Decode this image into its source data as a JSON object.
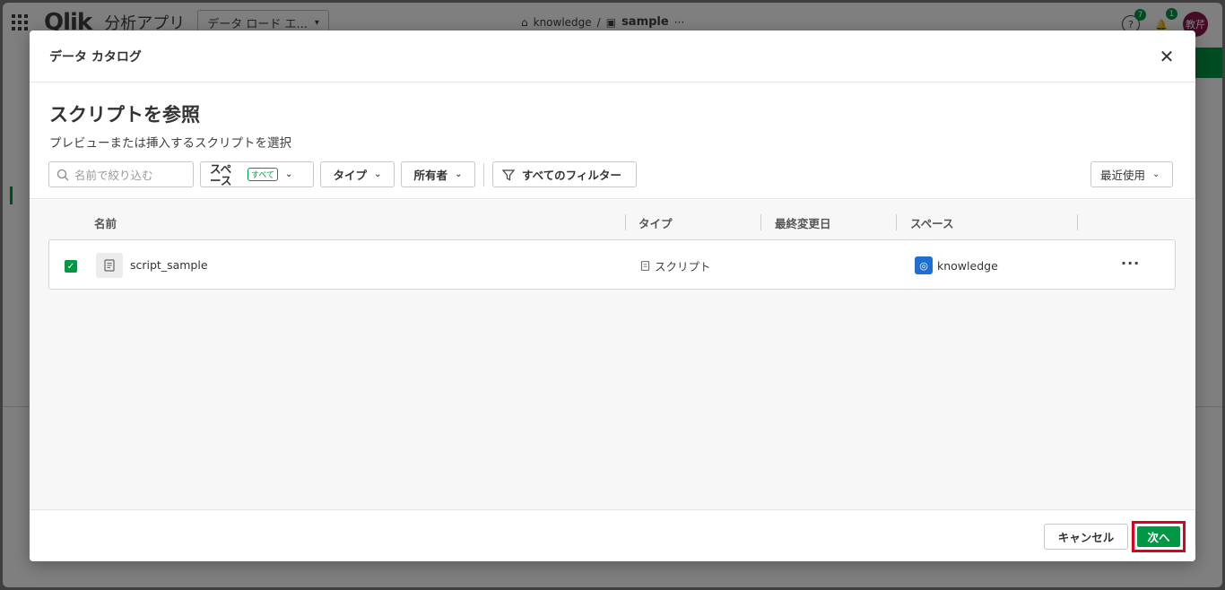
{
  "app": {
    "logo": "Qlik",
    "app_name": "分析アプリ",
    "editor_select": "データ ロード エ...",
    "crumb_space": "knowledge",
    "crumb_sep": "/",
    "crumb_app": "sample",
    "help_badge": "7",
    "notif_badge": "1",
    "avatar": "教芹"
  },
  "modal": {
    "title": "データ カタログ",
    "heading": "スクリプトを参照",
    "subheading": "プレビューまたは挿入するスクリプトを選択",
    "search_placeholder": "名前で絞り込む",
    "filters": {
      "space_label": "スペース",
      "space_tag": "すべて",
      "type_label": "タイプ",
      "owner_label": "所有者",
      "all_filters_label": "すべてのフィルター",
      "sort_label": "最近使用"
    },
    "columns": [
      "名前",
      "タイプ",
      "最終変更日",
      "スペース"
    ],
    "rows": [
      {
        "name": "script_sample",
        "type": "スクリプト",
        "modified": "",
        "space": "knowledge",
        "checked": true
      }
    ],
    "cancel_label": "キャンセル",
    "next_label": "次へ"
  },
  "colors": {
    "accent": "#009845",
    "highlight": "#e1001c",
    "space_icon": "#1f6fd1"
  }
}
